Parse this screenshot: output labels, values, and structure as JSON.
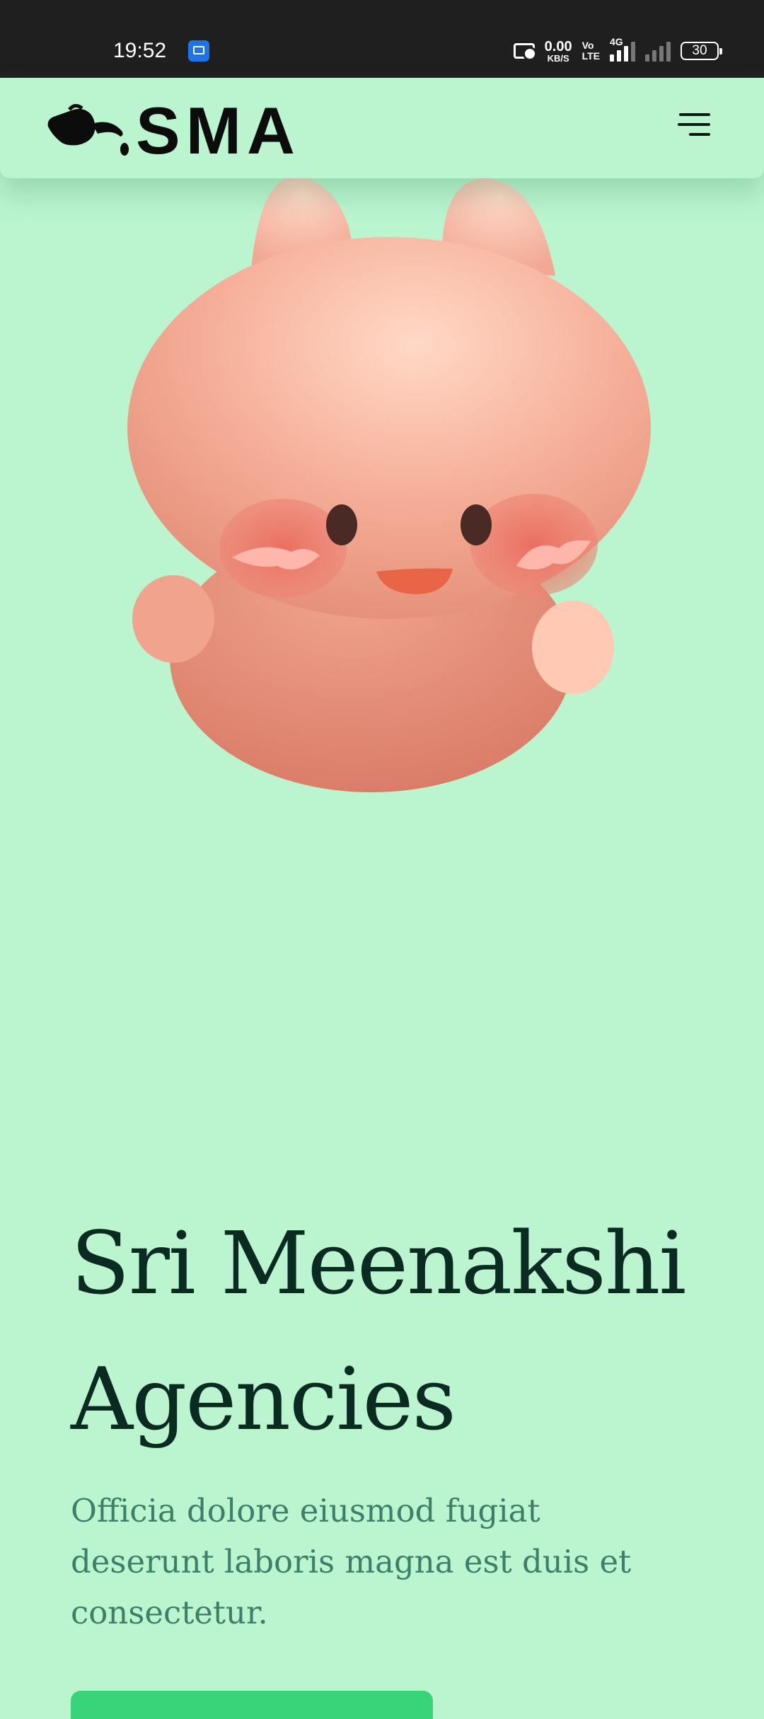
{
  "status_bar": {
    "time": "19:52",
    "net_speed_value": "0.00",
    "net_speed_unit": "KB/S",
    "volte_top": "Vo",
    "volte_bottom": "LTE",
    "network_type": "4G",
    "battery": "30"
  },
  "header": {
    "logo_text": "SMA",
    "icons": {
      "logo": "teapot-logo-icon",
      "menu": "hamburger-menu-icon"
    }
  },
  "hero": {
    "image": "pink-cat-mascot-illustration",
    "title": "Sri Meenakshi Agencies",
    "subtitle": "Officia dolore eiusmod fugiat deserunt laboris magna est duis et consectetur."
  },
  "colors": {
    "page_background": "#baf5cf",
    "title": "#0a2a22",
    "subtitle": "#3d7f6a",
    "cta": "#39d47a",
    "mascot_body": "#f2a38f"
  }
}
